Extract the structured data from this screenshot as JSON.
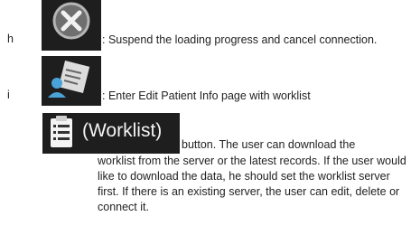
{
  "items": [
    {
      "letter": "h",
      "icon": "cancel-icon",
      "text": ": Suspend the loading progress and cancel connection."
    },
    {
      "letter": "i",
      "icon": "edit-patient-info-icon",
      "text": ": Enter Edit Patient Info page with worklist"
    }
  ],
  "worklist": {
    "icon": "clipboard-list-icon",
    "label": "(Worklist)",
    "inline_text": "button. The user can download the",
    "lines": [
      "worklist from the server or the latest records. If the user would",
      "like to download the data, he should set the worklist server",
      "first. If there is an existing server, the user can edit, delete or",
      "connect it."
    ]
  }
}
